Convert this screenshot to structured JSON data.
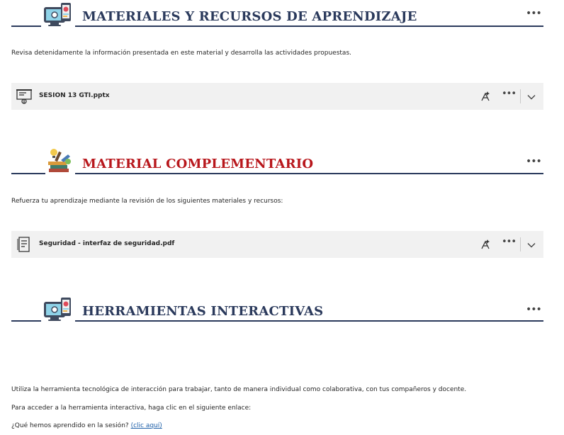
{
  "sections": [
    {
      "title": "MATERIALES Y RECURSOS DE APRENDIZAJE",
      "icon": "computer-tablet-icon",
      "intro": "Revisa detenidamente la información presentada en este material y desarrolla las actividades propuestas.",
      "file": {
        "name": "SESION 13 GTI.pptx",
        "icon": "presentation-file-icon"
      }
    },
    {
      "title": "MATERIAL COMPLEMENTARIO",
      "icon": "books-idea-icon",
      "intro": "Refuerza tu aprendizaje mediante la revisión de los siguientes materiales y recursos:",
      "file": {
        "name": "Seguridad - interfaz de seguridad.pdf",
        "icon": "document-file-icon"
      }
    },
    {
      "title": "HERRAMIENTAS INTERACTIVAS",
      "icon": "computer-tablet-icon",
      "lines": [
        "Utiliza la herramienta tecnológica de interacción para trabajar, tanto de manera individual como colaborativa, con tus compañeros y docente.",
        "Para acceder a la herramienta interactiva, haga clic en el siguiente enlace:"
      ],
      "question": "¿Qué hemos aprendido en la sesión?",
      "link": "(clic aquí)"
    }
  ],
  "more_label": "•••",
  "colors": {
    "navy": "#2b3a5c",
    "red": "#b8171c",
    "row_bg": "#f1f1f1",
    "link": "#1e5fa8"
  }
}
